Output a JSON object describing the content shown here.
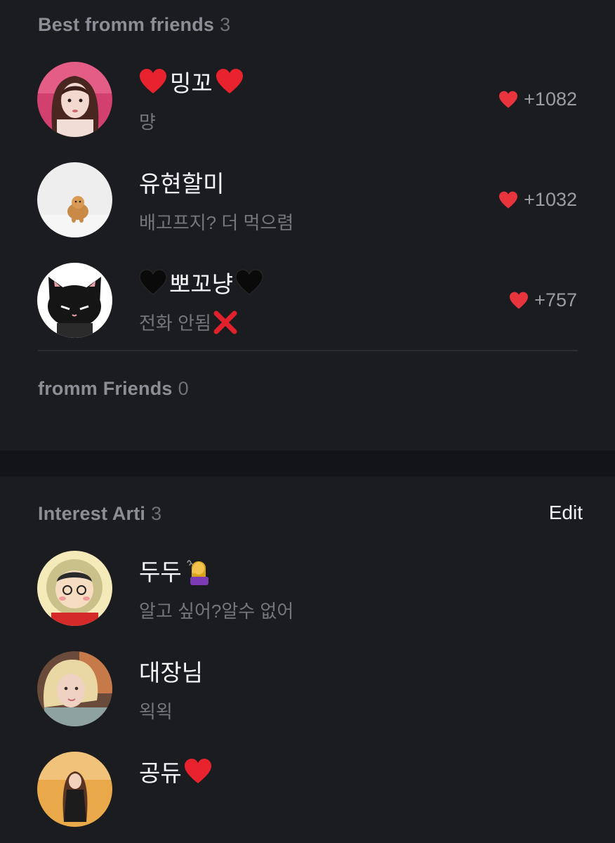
{
  "best_section": {
    "title": "Best fromm friends",
    "count": "3",
    "items": [
      {
        "name_pre": "",
        "name": "밍꼬",
        "name_post": "",
        "name_icon": "red-heart",
        "status": "먕",
        "likes": "+1082"
      },
      {
        "name": "유현할미",
        "status": "배고프지? 더 먹으렴",
        "likes": "+1032"
      },
      {
        "name": "뽀꼬냥",
        "name_icon": "black-heart",
        "status": "전화 안됨",
        "status_icon": "cross-mark",
        "likes": "+757"
      }
    ]
  },
  "friends_section": {
    "title": "fromm Friends",
    "count": "0"
  },
  "interest_section": {
    "title": "Interest Arti",
    "count": "3",
    "edit_label": "Edit",
    "items": [
      {
        "name": "두두",
        "name_icon": "person-tipping-hand",
        "status": "알고 싶어?알수 없어"
      },
      {
        "name": "대장님",
        "status": "왹왹"
      },
      {
        "name": "공듀",
        "name_icon": "red-heart",
        "status": ""
      }
    ]
  },
  "colors": {
    "background": "#1b1c20",
    "band": "#131417",
    "heart": "#e8343d",
    "muted_text": "#75767d"
  }
}
